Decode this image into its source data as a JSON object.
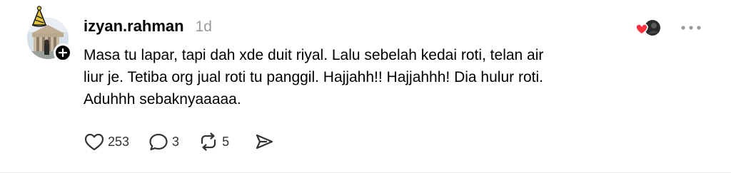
{
  "post": {
    "username": "izyan.rahman",
    "timestamp": "1d",
    "text": "Masa tu lapar, tapi dah xde duit riyal. Lalu sebelah kedai roti, telan air\nliur je. Tetiba org jual roti tu panggil. Hajjahh!! Hajjahhh! Dia hulur roti.\nAduhhh sebaknyaaaaa."
  },
  "actions": {
    "like_count": "253",
    "reply_count": "3",
    "repost_count": "5"
  },
  "colors": {
    "heart": "#ff3040",
    "muted": "#999999"
  },
  "icons": {
    "like": "heart-outline-icon",
    "reply": "speech-bubble-icon",
    "repost": "repost-arrows-icon",
    "share": "send-icon",
    "more": "ellipsis-icon",
    "follow": "plus-icon",
    "reaction": "heart-reaction-icon",
    "badge": "party-hat-icon"
  }
}
